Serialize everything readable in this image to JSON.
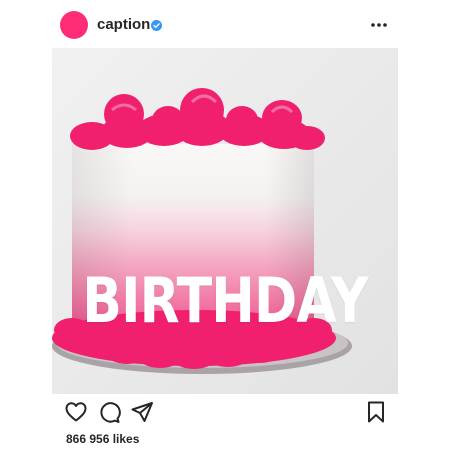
{
  "post": {
    "username": "caption",
    "verified": true,
    "avatar_color": "#ff2d78",
    "verified_color": "#3897f0",
    "more_icon": "more-horizontal-icon",
    "image": {
      "overlay_text": "BIRTHDAY",
      "frosting_color": "#f0206e",
      "background_color": "#ebebeb"
    },
    "actions": {
      "like_icon": "heart-icon",
      "comment_icon": "comment-icon",
      "share_icon": "send-icon",
      "save_icon": "bookmark-icon"
    },
    "likes_text": "866 956 likes"
  }
}
